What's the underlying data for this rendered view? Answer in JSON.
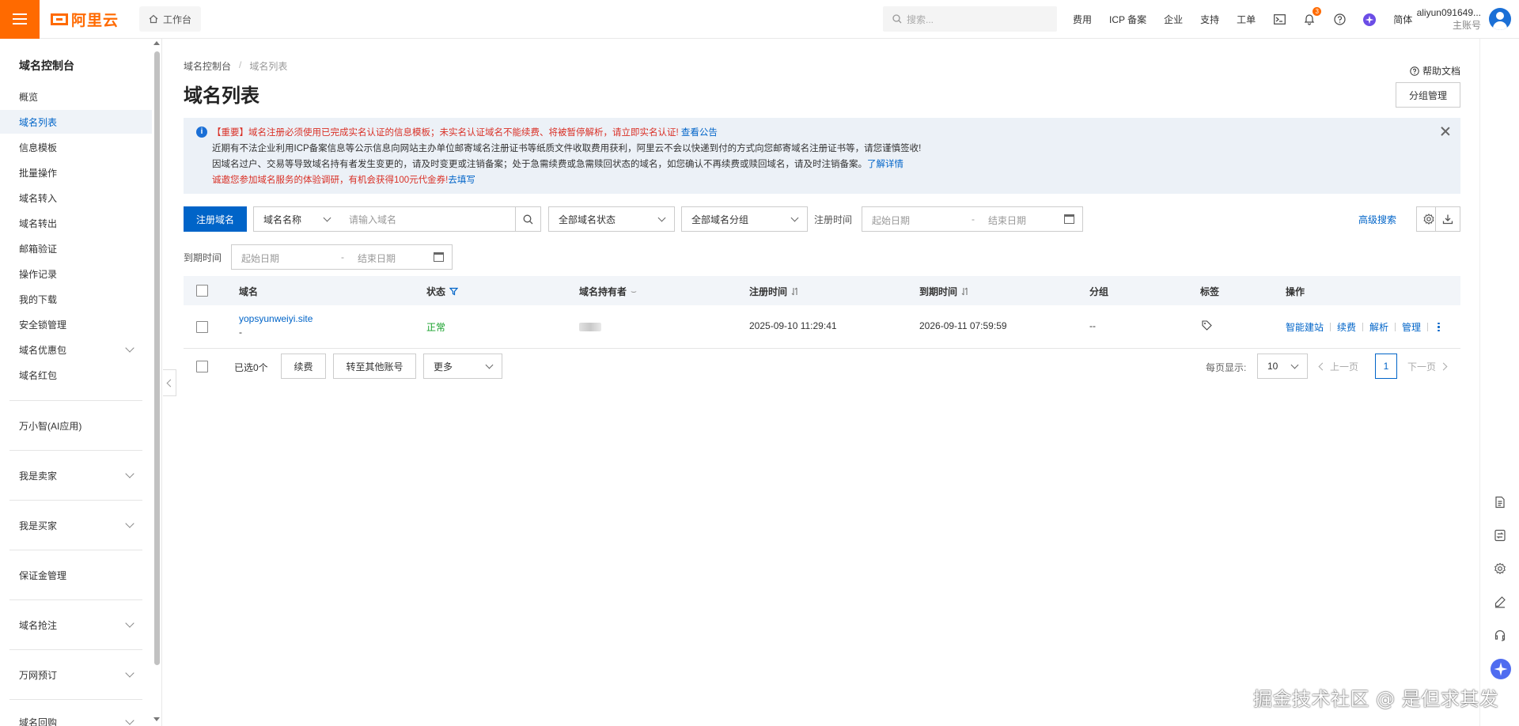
{
  "header": {
    "logo_text": "阿里云",
    "workbench_label": "工作台",
    "search_placeholder": "搜索...",
    "links": [
      "费用",
      "ICP 备案",
      "企业",
      "支持",
      "工单"
    ],
    "bell_badge": "3",
    "lang": "简体",
    "user_name": "aliyun091649...",
    "user_role": "主账号",
    "accent_color": "#ff6a00"
  },
  "sidebar": {
    "title": "域名控制台",
    "items": [
      {
        "label": "概览"
      },
      {
        "label": "域名列表",
        "active": true
      },
      {
        "label": "信息模板"
      },
      {
        "label": "批量操作"
      },
      {
        "label": "域名转入"
      },
      {
        "label": "域名转出"
      },
      {
        "label": "邮箱验证"
      },
      {
        "label": "操作记录"
      },
      {
        "label": "我的下载"
      },
      {
        "label": "安全锁管理"
      },
      {
        "label": "域名优惠包",
        "expandable": true
      },
      {
        "label": "域名红包"
      }
    ],
    "sections": [
      {
        "label": "万小智(AI应用)"
      },
      {
        "label": "我是卖家",
        "expandable": true
      },
      {
        "label": "我是买家",
        "expandable": true
      },
      {
        "label": "保证金管理"
      },
      {
        "label": "域名抢注",
        "expandable": true
      },
      {
        "label": "万网预订",
        "expandable": true
      },
      {
        "label": "域名回购",
        "expandable": true
      }
    ]
  },
  "page": {
    "breadcrumb": [
      "域名控制台",
      "域名列表"
    ],
    "title": "域名列表",
    "help_label": "帮助文档",
    "group_button": "分组管理"
  },
  "notice": {
    "line1_red": "【重要】域名注册必须使用已完成实名认证的信息模板；未实名认证域名不能续费、将被暂停解析，请立即实名认证!",
    "line1_link": "查看公告",
    "line2": "近期有不法企业利用ICP备案信息等公示信息向网站主办单位邮寄域名注册证书等纸质文件收取费用获利，阿里云不会以快递到付的方式向您邮寄域名注册证书等，请您谨慎签收!",
    "line3": "因域名过户、交易等导致域名持有者发生变更的，请及时变更或注销备案；处于急需续费或急需赎回状态的域名，如您确认不再续费或赎回域名，请及时注销备案。",
    "line3_link": "了解详情",
    "line4_red": "诚邀您参加域名服务的体验调研，有机会获得100元代金券!",
    "line4_link": "去填写"
  },
  "filters": {
    "register_button": "注册域名",
    "field_select": "域名名称",
    "domain_placeholder": "请输入域名",
    "status_select": "全部域名状态",
    "group_select": "全部域名分组",
    "reg_time_label": "注册时间",
    "start_placeholder": "起始日期",
    "end_placeholder": "结束日期",
    "advanced_search": "高级搜索",
    "expire_time_label": "到期时间",
    "date_sep": "-"
  },
  "table": {
    "columns": [
      "域名",
      "状态",
      "域名持有者",
      "注册时间",
      "到期时间",
      "分组",
      "标签",
      "操作"
    ],
    "rows": [
      {
        "domain": "yopsyunweiyi.site",
        "domain_sub": "-",
        "status": "正常",
        "reg_time": "2025-09-10 11:29:41",
        "expire_time": "2026-09-11 07:59:59",
        "group": "--",
        "ops": [
          "智能建站",
          "续费",
          "解析",
          "管理"
        ]
      }
    ]
  },
  "footer": {
    "selected": "已选0个",
    "renew_button": "续费",
    "transfer_button": "转至其他账号",
    "more_select": "更多",
    "page_size_label": "每页显示:",
    "page_size": "10",
    "prev": "上一页",
    "current_page": "1",
    "next": "下一页"
  },
  "watermark": "掘金技术社区 @ 是但求其发"
}
